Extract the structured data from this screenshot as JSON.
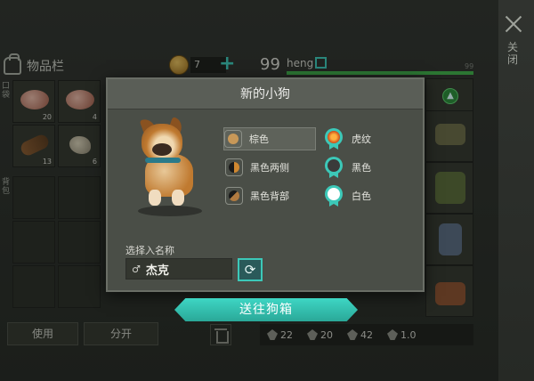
{
  "close": {
    "label": "关闭"
  },
  "inventory": {
    "title": "物品栏",
    "side_tab_top": "口袋",
    "side_tab_bottom": "背包",
    "items": [
      {
        "icon": "raw-meat-icon",
        "qty": "20"
      },
      {
        "icon": "raw-meat-icon",
        "qty": "4"
      },
      {
        "icon": "log-icon",
        "qty": "13"
      },
      {
        "icon": "stone-icon",
        "qty": "6"
      }
    ],
    "use_button": "使用",
    "split_button": "分开"
  },
  "currency": {
    "coins": "7",
    "plus": "+"
  },
  "player": {
    "level": "99",
    "name": "heng",
    "xp_fraction": 1.0,
    "xp_max": "99"
  },
  "stats": [
    {
      "icon": "sword-icon",
      "value": "22"
    },
    {
      "icon": "shield-icon",
      "value": "20"
    },
    {
      "icon": "running-icon",
      "value": "42"
    },
    {
      "icon": "hammer-icon",
      "value": "1.0"
    }
  ],
  "dialog": {
    "title": "新的小狗",
    "fur_colors": [
      {
        "label": "棕色",
        "color": "#c89858",
        "selected": true
      },
      {
        "label": "黑色两侧",
        "color": "#d08830",
        "selected": false
      },
      {
        "label": "黑色背部",
        "color": "#b07a40",
        "selected": false
      }
    ],
    "patterns": [
      {
        "label": "虎纹",
        "color": "#e07020"
      },
      {
        "label": "黑色",
        "color": "#3a3a3a"
      },
      {
        "label": "白色",
        "color": "#ffffff"
      }
    ],
    "name_prompt": "选择入名称",
    "gender_symbol": "♂",
    "dog_name": "杰克",
    "refresh_symbol": "⟳",
    "go_kennel": "送往狗箱"
  },
  "colors": {
    "accent": "#3cc8b8",
    "xp": "#3fb04a"
  }
}
